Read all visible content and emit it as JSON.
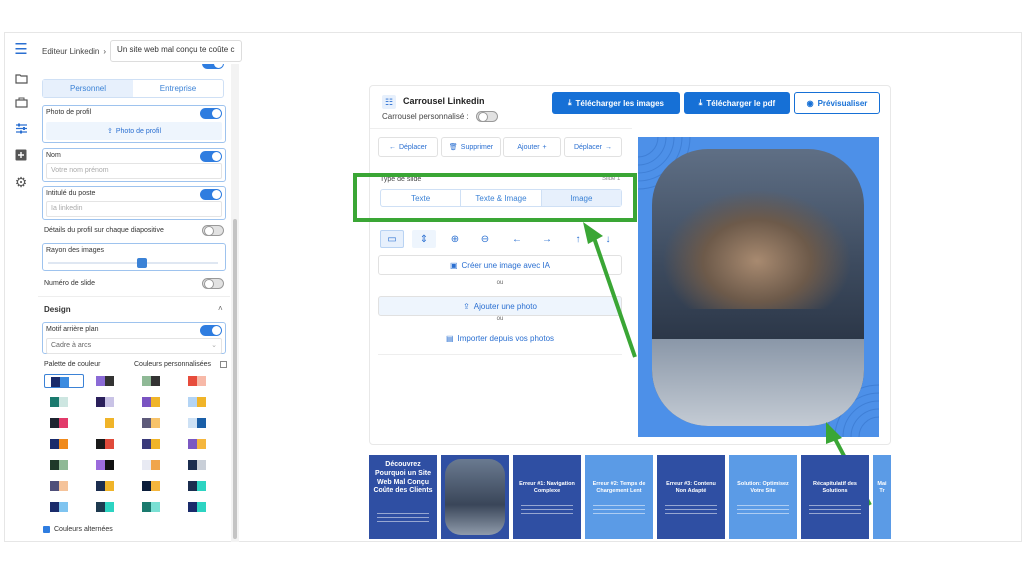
{
  "topbar": {
    "crumb": "Editeur Linkedin",
    "crumb_sep": "›",
    "title_value": "Un site web mal conçu te coûte c"
  },
  "sidebar": {
    "seg": [
      "Personnel",
      "Entreprise"
    ],
    "photo_label": "Photo de profil",
    "photo_button": "Photo de profil",
    "nom_label": "Nom",
    "nom_placeholder": "Votre nom prénom",
    "poste_label": "Intitulé du poste",
    "poste_placeholder": "Ia linkedin",
    "details_label": "Détails du profil sur chaque diapositive",
    "rayon_label": "Rayon des images",
    "rayon_level": 0.55,
    "numero_label": "Numéro de slide",
    "design_title": "Design",
    "motif_label": "Motif arrière plan",
    "motif_value": "Cadre à arcs",
    "palette_label": "Palette de couleur",
    "perso_label": "Couleurs personnalisées",
    "alternees_label": "Couleurs alternées"
  },
  "editor": {
    "title": "Carrousel Linkedin",
    "perso_label": "Carrousel personnalisé :",
    "btn_images": "Télécharger les images",
    "btn_pdf": "Télécharger le pdf",
    "btn_preview": "Prévisualiser",
    "tools": [
      "Déplacer",
      "Supprimer",
      "Ajouter",
      "Déplacer"
    ],
    "type_label": "Type de slide",
    "slide_counter": "Slide 1",
    "type_tabs": [
      "Texte",
      "Texte & Image",
      "Image"
    ],
    "create_ai": "Créer une image avec IA",
    "ou": "ou",
    "add_photo": "Ajouter une photo",
    "import": "Importer depuis vos photos"
  },
  "thumbnails": [
    {
      "title": "Découvrez Pourquoi un Site Web Mal Conçu Coûte des Clients"
    },
    {
      "title": ""
    },
    {
      "title": "Erreur #1: Navigation Complexe"
    },
    {
      "title": "Erreur #2: Temps de Chargement Lent"
    },
    {
      "title": "Erreur #3: Contenu Non Adapté"
    },
    {
      "title": "Solution: Optimisez Votre Site"
    },
    {
      "title": "Récapitulatif des Solutions"
    },
    {
      "title": "Mai Tr"
    }
  ],
  "colors": {
    "accent": "#1670d6",
    "green": "#3aa635",
    "slide_dark": "#2f4fa3",
    "slide_light": "#5b9be6"
  }
}
